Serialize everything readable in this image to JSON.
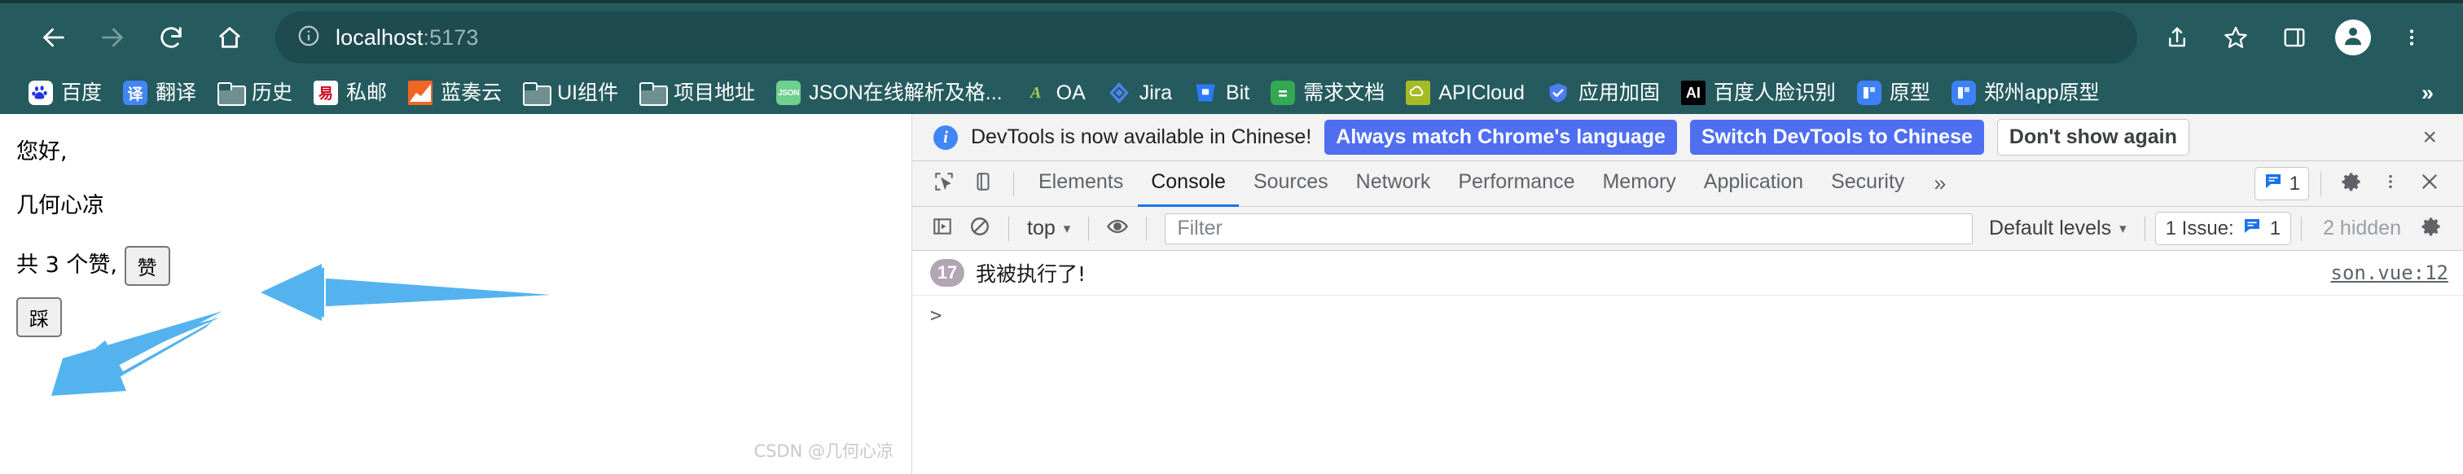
{
  "browser": {
    "nav": {
      "back": "back-arrow",
      "forward": "forward-arrow",
      "reload": "reload",
      "home": "home"
    },
    "omnibox": {
      "security_icon": "info-circle-icon",
      "url_host": "localhost",
      "url_port": ":5173"
    },
    "right_actions": [
      "share-icon",
      "bookmark-star-icon",
      "side-panel-icon",
      "profile-avatar-icon",
      "three-dot-menu-icon"
    ]
  },
  "bookmarks": {
    "overflow_label": "»",
    "items": [
      {
        "label": "百度",
        "icon": "baidu-paw-icon",
        "icon_type": "img",
        "bg": "#ffffff",
        "fg": "#2932e1",
        "glyph": "du"
      },
      {
        "label": "翻译",
        "icon": "translate-icon",
        "icon_type": "img",
        "bg": "#4285f4",
        "fg": "#ffffff",
        "glyph": "译"
      },
      {
        "label": "历史",
        "icon": "folder-icon",
        "icon_type": "folder",
        "bg": "",
        "fg": "",
        "glyph": ""
      },
      {
        "label": "私邮",
        "icon": "mail-icon",
        "icon_type": "img",
        "bg": "#ffffff",
        "fg": "#d0021b",
        "glyph": "邑"
      },
      {
        "label": "蓝奏云",
        "icon": "lanzou-icon",
        "icon_type": "img",
        "bg": "#f26522",
        "fg": "#ffffff",
        "glyph": ""
      },
      {
        "label": "UI组件",
        "icon": "folder-icon",
        "icon_type": "folder",
        "bg": "",
        "fg": "",
        "glyph": ""
      },
      {
        "label": "项目地址",
        "icon": "folder-icon",
        "icon_type": "folder",
        "bg": "",
        "fg": "",
        "glyph": ""
      },
      {
        "label": "JSON在线解析及格...",
        "icon": "json-icon",
        "icon_type": "img",
        "bg": "#6ecf8e",
        "fg": "#ffffff",
        "glyph": "JSON"
      },
      {
        "label": "OA",
        "icon": "oa-icon",
        "icon_type": "img",
        "bg": "#255b5f",
        "fg": "#a9cc52",
        "glyph": "A"
      },
      {
        "label": "Jira",
        "icon": "jira-icon",
        "icon_type": "img",
        "bg": "#255b5f",
        "fg": "#4c84f5",
        "glyph": "◆"
      },
      {
        "label": "Bit",
        "icon": "bitbucket-icon",
        "icon_type": "img",
        "bg": "#2a7bf6",
        "fg": "#ffffff",
        "glyph": ""
      },
      {
        "label": "需求文档",
        "icon": "docs-icon",
        "icon_type": "img",
        "bg": "#34a853",
        "fg": "#ffffff",
        "glyph": "≡"
      },
      {
        "label": "APICloud",
        "icon": "apicloud-icon",
        "icon_type": "img",
        "bg": "#a5bb23",
        "fg": "#ffffff",
        "glyph": "☁"
      },
      {
        "label": "应用加固",
        "icon": "shield-check-icon",
        "icon_type": "img",
        "bg": "#255b5f",
        "fg": "#4f7cf7",
        "glyph": "✓"
      },
      {
        "label": "百度人脸识别",
        "icon": "ai-icon",
        "icon_type": "img",
        "bg": "#000000",
        "fg": "#ffffff",
        "glyph": "AI"
      },
      {
        "label": "原型",
        "icon": "axure-icon",
        "icon_type": "img",
        "bg": "#3c82f6",
        "fg": "#ffffff",
        "glyph": "▯"
      },
      {
        "label": "郑州app原型",
        "icon": "axure-icon",
        "icon_type": "img",
        "bg": "#3c82f6",
        "fg": "#ffffff",
        "glyph": "▯"
      }
    ]
  },
  "page": {
    "greeting": "您好,",
    "name": "几何心凉",
    "vote_text": "共 3 个赞, ",
    "like_button": "赞",
    "dislike_button": "踩",
    "watermark": "CSDN @几何心凉"
  },
  "devtools": {
    "banner": {
      "message": "DevTools is now available in Chinese!",
      "primary_button": "Always match Chrome's language",
      "secondary_button": "Switch DevTools to Chinese",
      "tertiary_button": "Don't show again",
      "close": "×",
      "accent": "#4f6ff0"
    },
    "tabs": [
      {
        "label": "Elements",
        "active": false
      },
      {
        "label": "Console",
        "active": true
      },
      {
        "label": "Sources",
        "active": false
      },
      {
        "label": "Network",
        "active": false
      },
      {
        "label": "Performance",
        "active": false
      },
      {
        "label": "Memory",
        "active": false
      },
      {
        "label": "Application",
        "active": false
      },
      {
        "label": "Security",
        "active": false
      }
    ],
    "tabs_more": "»",
    "issue_count": "1",
    "console_toolbar": {
      "context": "top",
      "caret": "▾",
      "filter_placeholder": "Filter",
      "levels": "Default levels",
      "issues_label": "1 Issue:",
      "issues_count": "1",
      "hidden": "2 hidden"
    },
    "console_log": [
      {
        "count": "17",
        "text": "我被执行了!",
        "source": "son.vue:12"
      }
    ],
    "prompt": ">"
  }
}
